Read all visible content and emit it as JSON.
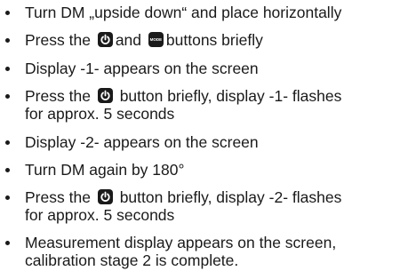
{
  "instructions": {
    "items": [
      {
        "text": "Turn DM „upside down“ and place horizontally"
      },
      {
        "before": "Press the",
        "middle": "and",
        "after": "buttons briefly",
        "icon_1": "power-icon",
        "icon_2": "mode-button-icon"
      },
      {
        "text": "Display -1- appears on the screen"
      },
      {
        "before": "Press the",
        "after": "button briefly, display -1- flashes",
        "line2": "for approx. 5 seconds",
        "icon_1": "power-icon"
      },
      {
        "text": "Display -2- appears on the screen"
      },
      {
        "text": "Turn DM again by 180°"
      },
      {
        "before": "Press the",
        "after": "button briefly, display -2- flashes",
        "line2": "for approx. 5 seconds",
        "icon_1": "power-icon"
      },
      {
        "text": "Measurement display appears on the screen,",
        "line2": "calibration stage 2 is complete."
      }
    ],
    "mode_button_label": "MODE"
  }
}
